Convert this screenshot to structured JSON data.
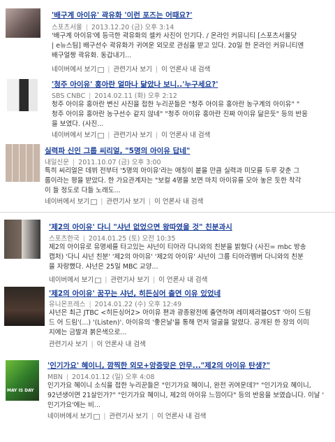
{
  "results": [
    {
      "title": "'배구계 아이유' 곽유화 '이런 포즈는 어때요?'",
      "source": "스포츠서울",
      "date": "2013.12.20 (금) 오후 3:14",
      "snippet": [
        "'배구계 아이유'에 등극한 곽유화의 셀카 사진이 인기다. / 온라인 커뮤니티 [스포츠서울닷",
        "| e뉴스팀] 배구선수 곽유화가 귀여운 외모로 관심을 받고 있다. 20일 한 온라인 커뮤니티엔",
        "배구얼짱 곽유화. 동갑내기..."
      ],
      "links": [
        "네이버에서 보기",
        "관련기사 보기",
        "이 언론사 내 검색"
      ]
    },
    {
      "title": "'청주 아이유' 홍아란 얼마나 닮았나 보니..'누구세요?'",
      "source": "SBS CNBC",
      "date": "2014.02.11 (화) 오후 2:12",
      "snippet": [
        "청주 아이유 홍아란 변신 사진을 접한 누리꾼들은 \"청주 아이유 홍아란 농구계의 아이유\" \"",
        "청주 아이유 홍아란 농구선수 같지 않네\" \"청주 아이유 홍아란 진짜 아이유 닮은듯\" 등의 반응",
        "을 보였다. (사진..."
      ],
      "links": [
        "네이버에서 보기",
        "관련기사 보기",
        "이 언론사 내 검색"
      ]
    },
    {
      "title": "실력파 신인 그룹 씨리얼, \"5명의 아이유 답네\"",
      "source": "내일신문",
      "date": "2011.10.07 (금) 오후 3:00",
      "snippet": [
        "특히 씨리얼은 데뷔 전부터 '5명의 아이유'라는 애칭이 붙을 만큼 실력과 미모를 두루 갖춘 그",
        "룹이라는 평을 받았다. 한 가요관계자는 \"보컬 4명을 보면 마치 아이유를 모아 놓은 듯한 착각",
        "이 들 정도로 다들 노래도..."
      ],
      "links": [
        "네이버에서 보기",
        "관련기사 보기",
        "이 언론사 내 검색"
      ]
    },
    {
      "title": "'제2의 아이유' 다니 \"샤넌 없었으면 왕따였을 것\" 친분과시",
      "source": "스포츠한국",
      "date": "2014.01.25 (토) 오전 10:35",
      "snippet": [
        "제2의 아이유로 유명세를 타고있는 샤넌이 티아라 다니와의 친분을 밝혔다 (사진= mbc 방송",
        "캡처) '다니 샤넌 친분' '제2의 아이유' '제2의 아이유' 샤넌이 그룹 티아라멤버 다니와의 친분",
        "을 자랑했다. 샤넌은 25일 MBC 교양..."
      ],
      "links": [
        "네이버에서 보기",
        "관련기사 보기",
        "이 언론사 내 검색"
      ]
    },
    {
      "title": "'제2의 아이유' 꿈꾸는 샤넌, 히든싱어 출연 이유 있었네",
      "source": "유니온프레스",
      "date": "2014.01.22 (수) 오후 12:49",
      "snippet": [
        "샤넌은 최근 JTBC <히든싱어2> 아이유 편과 광종왕전에 출연하며 레미제라블OST '아이 드림",
        "드 어 드림'(...) '(Listen)'. 아이유의 '좋은날'을 통해 먼저 얼굴을 알렸다. 공개된 한 장의 이미",
        "지에는 금발과 붉은색으로..."
      ],
      "links": [
        "관련기사 보기",
        "이 언론사 내 검색"
      ]
    },
    {
      "title": "'인기가요' 혜이니, 깜찍한 외모+앙증맞은 안무...\"제2의 아이유 탄생?\"",
      "source": "MBN",
      "date": "2014.01.12 (일) 오후 4:08",
      "snippet": [
        "인기가요 혜이니 소식을 접한 누리꾼들은 \"인기가요 혜이니, 완전 귀여운데?\" \"인기가요 혜이니,",
        "92년생이면 21살인가?\" \"인기가요 혜이니, 제2의 아이유 느낌이다\" 등의 반응을 보였습니다. 이날 '",
        "인기가요'에는 비..."
      ],
      "links": [
        "네이버에서 보기",
        "관련기사 보기",
        "이 언론사 내 검색"
      ]
    }
  ],
  "thumb_labels": {
    "album": "MAY IS DAY"
  }
}
